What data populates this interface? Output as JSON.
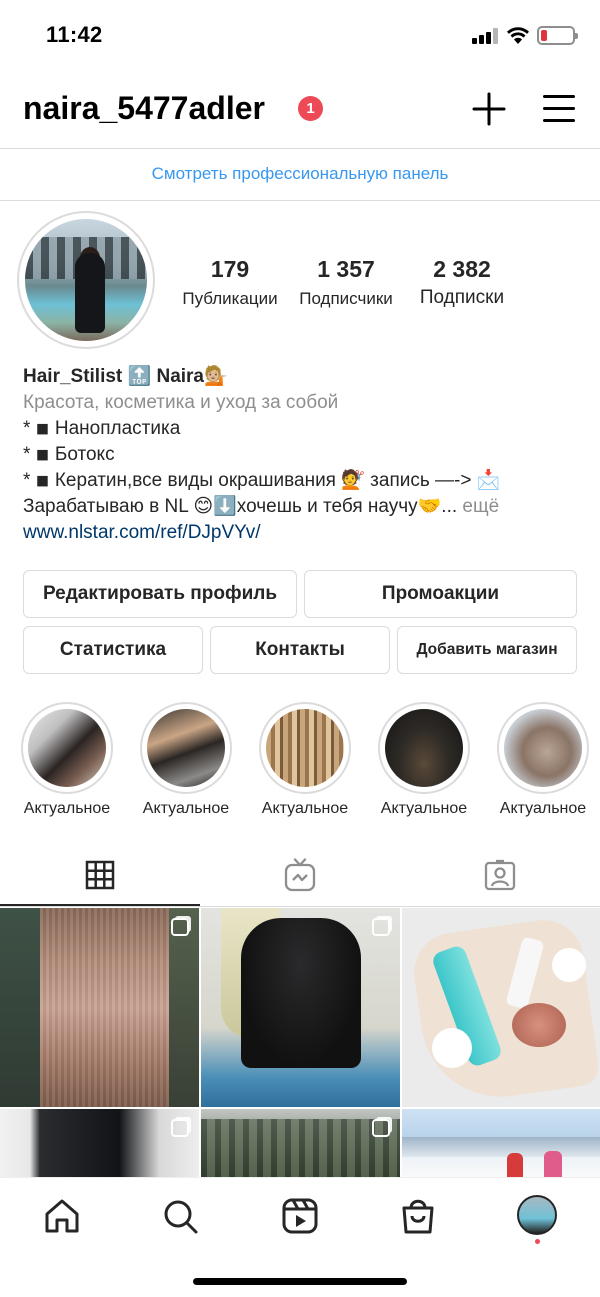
{
  "status_bar": {
    "time": "11:42",
    "battery_level": 0.2,
    "battery_color": "#e0333e"
  },
  "header": {
    "username": "naira_5477adler",
    "notification_count": "1",
    "badge_color": "#ed4956"
  },
  "pro_panel": {
    "label": "Смотреть профессиональную панель",
    "color": "#3897f0"
  },
  "stats": [
    {
      "value": "179",
      "label": "Публикации"
    },
    {
      "value": "1 357",
      "label": "Подписчики"
    },
    {
      "value": "2 382",
      "label": "Подписки"
    }
  ],
  "bio": {
    "name": "Hair_Stilist 🔝 Naira💁🏼",
    "category": "Красота, косметика и уход за собой",
    "lines": [
      "* ◾ Нанопластика",
      "* ◾ Ботокс",
      "* ◾ Кератин,все виды окрашивания 💇 запись —-> 📩"
    ],
    "last_line": "Зарабатываю в NL 😊⬇️хочешь и тебя научу🤝...",
    "more": " ещё",
    "link": "www.nlstar.com/ref/DJpVYv/"
  },
  "buttons": {
    "edit_profile": "Редактировать профиль",
    "promo": "Промоакции",
    "statistics": "Статистика",
    "contacts": "Контакты",
    "add_shop": "Добавить магазин"
  },
  "highlights": [
    {
      "label": "Актуальное",
      "icon": "hair-client-photo"
    },
    {
      "label": "Актуальное",
      "icon": "hair-client-photo"
    },
    {
      "label": "Актуальное",
      "icon": "hair-texture-photo"
    },
    {
      "label": "Актуальное",
      "icon": "long-hair-photo"
    },
    {
      "label": "Актуальное",
      "icon": "bob-haircut-photo"
    }
  ],
  "tabs": [
    {
      "name": "grid",
      "icon": "grid-icon",
      "active": true
    },
    {
      "name": "igtv",
      "icon": "igtv-icon",
      "active": false
    },
    {
      "name": "tagged",
      "icon": "tagged-icon",
      "active": false
    }
  ],
  "posts": [
    {
      "icon": "long-straight-hair-photo",
      "multi": true
    },
    {
      "icon": "bob-haircut-photo",
      "multi": true
    },
    {
      "icon": "cosmetics-products-photo",
      "multi": false
    },
    {
      "icon": "dark-hair-photo",
      "multi": true
    },
    {
      "icon": "park-trees-photo",
      "multi": true
    },
    {
      "icon": "mountain-snow-photo",
      "multi": false
    }
  ],
  "bottom_nav": [
    {
      "name": "home",
      "icon": "home-icon"
    },
    {
      "name": "search",
      "icon": "search-icon"
    },
    {
      "name": "reels",
      "icon": "reels-icon"
    },
    {
      "name": "shop",
      "icon": "shop-bag-icon"
    },
    {
      "name": "profile",
      "icon": "profile-avatar-icon"
    }
  ]
}
